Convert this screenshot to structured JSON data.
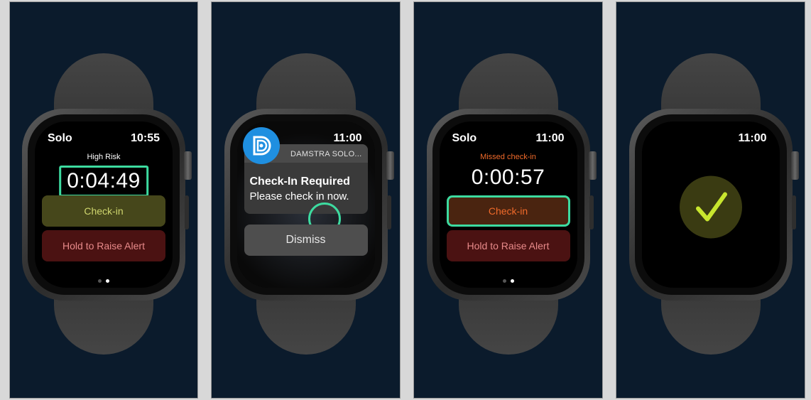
{
  "colors": {
    "background": "#0b1b2c",
    "checkin_bg": "#46471b",
    "checkin_text": "#cfd66e",
    "alert_bg": "#4b1212",
    "alert_text": "#e88a8a",
    "highlight": "#3ddba0",
    "missed": "#f06a2a",
    "notif_icon": "#1f8fe0",
    "success_check": "#c8e62e"
  },
  "screen1": {
    "app_name": "Solo",
    "time": "10:55",
    "risk_label": "High Risk",
    "timer": "0:04:49",
    "checkin_label": "Check-in",
    "alert_label": "Hold to Raise Alert",
    "page_index": 2,
    "page_count": 2
  },
  "screen2": {
    "time": "11:00",
    "app_icon": "damstra-logo-icon",
    "app_title": "DAMSTRA SOLO...",
    "title": "Check-In Required",
    "body": "Please check in now.",
    "dismiss_label": "Dismiss"
  },
  "screen3": {
    "app_name": "Solo",
    "time": "11:00",
    "status_label": "Missed check-in",
    "timer": "0:00:57",
    "checkin_label": "Check-in",
    "alert_label": "Hold to Raise Alert",
    "page_index": 2,
    "page_count": 2
  },
  "screen4": {
    "time": "11:00",
    "icon": "checkmark-icon"
  }
}
